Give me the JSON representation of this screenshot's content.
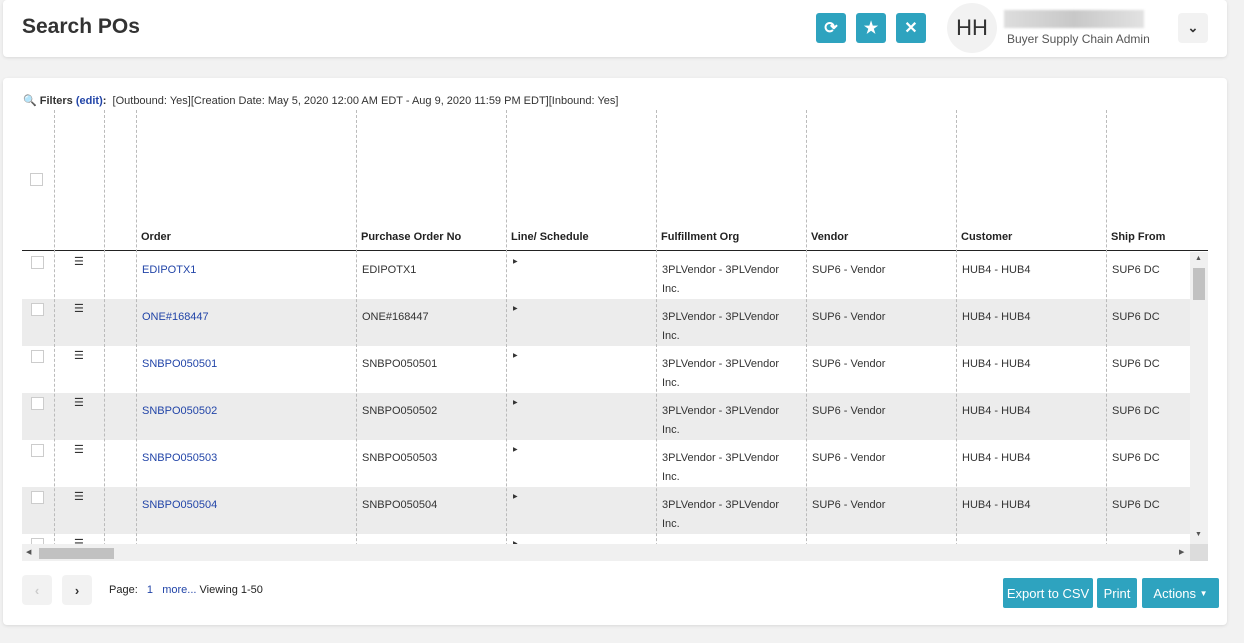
{
  "header": {
    "title": "Search POs",
    "avatar_initials": "HH",
    "user_role": "Buyer Supply Chain Admin",
    "buttons": {
      "refresh": "refresh-icon",
      "favorite": "star-icon",
      "close": "close-icon"
    }
  },
  "filters": {
    "label": "Filters",
    "edit": "(edit)",
    "colon": ":",
    "text": "[Outbound: Yes][Creation Date: May 5, 2020 12:00 AM EDT - Aug 9, 2020 11:59 PM EDT][Inbound: Yes]"
  },
  "columns": [
    "Order",
    "Purchase Order No",
    "Line/ Schedule",
    "Fulfillment Org",
    "Vendor",
    "Customer",
    "Ship From"
  ],
  "rows": [
    {
      "order": "EDIPOTX1",
      "po": "EDIPOTX1",
      "fulfillment": "3PLVendor - 3PLVendor",
      "fulfillment2": "Inc.",
      "vendor": "SUP6 - Vendor",
      "customer": "HUB4 - HUB4",
      "ship_from": "SUP6 DC"
    },
    {
      "order": "ONE#168447",
      "po": "ONE#168447",
      "fulfillment": "3PLVendor - 3PLVendor",
      "fulfillment2": "Inc.",
      "vendor": "SUP6 - Vendor",
      "customer": "HUB4 - HUB4",
      "ship_from": "SUP6 DC"
    },
    {
      "order": "SNBPO050501",
      "po": "SNBPO050501",
      "fulfillment": "3PLVendor - 3PLVendor",
      "fulfillment2": "Inc.",
      "vendor": "SUP6 - Vendor",
      "customer": "HUB4 - HUB4",
      "ship_from": "SUP6 DC"
    },
    {
      "order": "SNBPO050502",
      "po": "SNBPO050502",
      "fulfillment": "3PLVendor - 3PLVendor",
      "fulfillment2": "Inc.",
      "vendor": "SUP6 - Vendor",
      "customer": "HUB4 - HUB4",
      "ship_from": "SUP6 DC"
    },
    {
      "order": "SNBPO050503",
      "po": "SNBPO050503",
      "fulfillment": "3PLVendor - 3PLVendor",
      "fulfillment2": "Inc.",
      "vendor": "SUP6 - Vendor",
      "customer": "HUB4 - HUB4",
      "ship_from": "SUP6 DC"
    },
    {
      "order": "SNBPO050504",
      "po": "SNBPO050504",
      "fulfillment": "3PLVendor - 3PLVendor",
      "fulfillment2": "Inc.",
      "vendor": "SUP6 - Vendor",
      "customer": "HUB4 - HUB4",
      "ship_from": "SUP6 DC"
    }
  ],
  "pager": {
    "page_label": "Page:",
    "page": "1",
    "more": "more...",
    "viewing": "Viewing 1-50"
  },
  "actions": {
    "export": "Export to CSV",
    "print": "Print",
    "actions": "Actions"
  },
  "colors": {
    "accent": "#2ea3bf",
    "link": "#2245a8"
  }
}
